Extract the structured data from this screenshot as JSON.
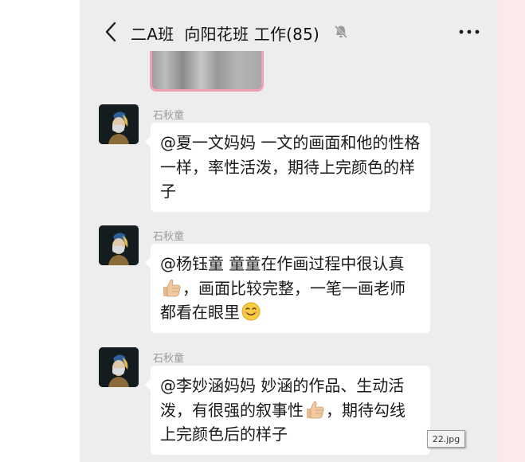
{
  "header": {
    "title": "二A班  向阳花班 工作(85)",
    "back_icon": "chevron-left-icon",
    "mute_icon": "bell-off-icon",
    "more_icon": "more-horizontal-icon"
  },
  "messages": [
    {
      "sender": "石秋童",
      "parts": [
        "@夏一文妈妈  一文的画面和他的性格一样，率性活泼，期待上完颜色的样子"
      ]
    },
    {
      "sender": "石秋童",
      "parts": [
        "@杨钰童  童童在作画过程中很认真",
        "thumbs-up-emoji",
        "，画面比较完整，一笔一画老师都看在眼里",
        "smiling-face-emoji"
      ]
    },
    {
      "sender": "石秋童",
      "parts": [
        "@李妙涵妈妈  妙涵的作品、生动活泼，有很强的叙事性",
        "thumbs-up-emoji",
        "，期待勾线上完颜色后的样子"
      ]
    }
  ],
  "file_label": "22.jpg",
  "colors": {
    "chat_background": "#ededed",
    "bubble": "#ffffff",
    "sender_name": "#9a9a9a",
    "image_border": "#f2a1b5"
  }
}
